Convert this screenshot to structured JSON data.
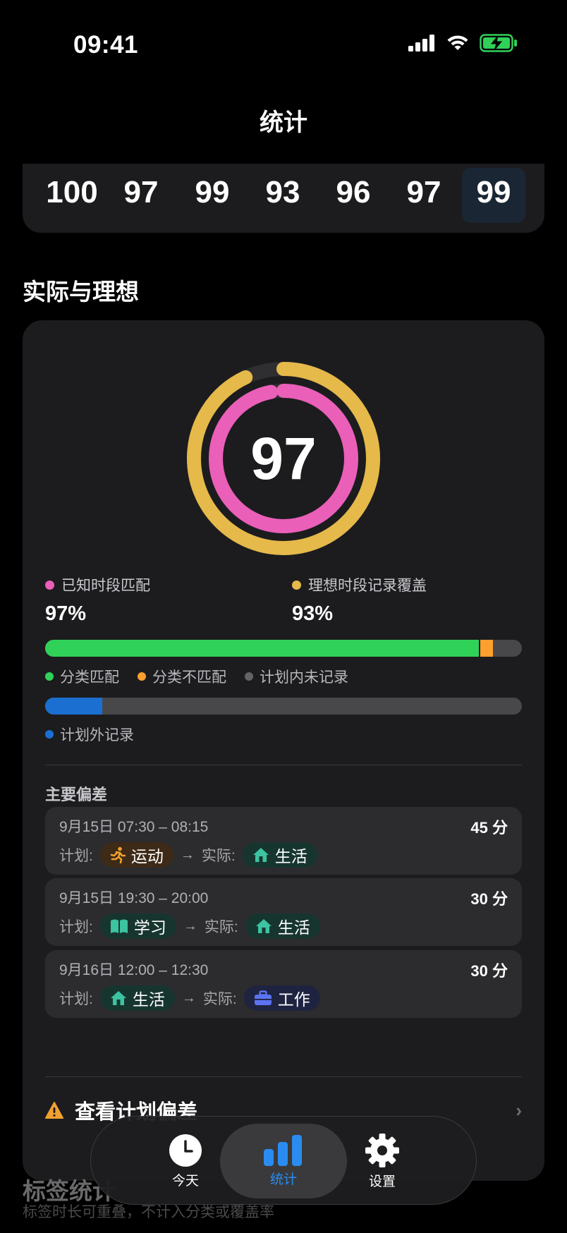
{
  "status": {
    "time": "09:41"
  },
  "nav": {
    "title": "统计"
  },
  "scores": [
    "100",
    "97",
    "99",
    "93",
    "96",
    "97",
    "99"
  ],
  "selected_score_index": 6,
  "section": {
    "title": "实际与理想"
  },
  "ring": {
    "score": "97",
    "inner_fraction": 0.97,
    "outer_fraction": 0.93,
    "inner_color": "#ea5fb8",
    "outer_color": "#e5b94a"
  },
  "metrics": [
    {
      "label": "已知时段匹配",
      "value": "97%",
      "color": "#ea5fb8"
    },
    {
      "label": "理想时段记录覆盖",
      "value": "93%",
      "color": "#e5b94a"
    }
  ],
  "bar1": {
    "segments": [
      {
        "fraction": 0.91,
        "color": "#30d158"
      },
      {
        "fraction": 0.03,
        "color": "#ff9f2e"
      }
    ],
    "legend": [
      {
        "label": "分类匹配",
        "color": "#30d158"
      },
      {
        "label": "分类不匹配",
        "color": "#ff9f2e"
      },
      {
        "label": "计划内未记录",
        "color": "#636366"
      }
    ]
  },
  "bar2": {
    "segments": [
      {
        "fraction": 0.12,
        "color": "#1a6fd0"
      }
    ],
    "legend": [
      {
        "label": "计划外记录",
        "color": "#1a6fd0"
      }
    ]
  },
  "deviations": {
    "title": "主要偏差",
    "plan_label": "计划:",
    "actual_label": "实际:",
    "items": [
      {
        "when": "9月15日  07:30 – 08:15",
        "duration": "45 分",
        "plan": "运动",
        "plan_icon": "running-icon",
        "actual": "生活",
        "actual_icon": "house-icon"
      },
      {
        "when": "9月15日  19:30 – 20:00",
        "duration": "30 分",
        "plan": "学习",
        "plan_icon": "book-icon",
        "actual": "生活",
        "actual_icon": "house-icon"
      },
      {
        "when": "9月16日  12:00 – 12:30",
        "duration": "30 分",
        "plan": "生活",
        "plan_icon": "house-icon",
        "actual": "工作",
        "actual_icon": "briefcase-icon"
      }
    ]
  },
  "view_deviation": {
    "label": "查看计划偏差"
  },
  "below": {
    "title": "标签统计",
    "subtitle": "标签时长可重叠，不计入分类或覆盖率"
  },
  "tabs": [
    {
      "label": "今天",
      "icon": "clock-icon"
    },
    {
      "label": "统计",
      "icon": "chart-icon"
    },
    {
      "label": "设置",
      "icon": "gear-icon"
    }
  ],
  "active_tab": 1
}
